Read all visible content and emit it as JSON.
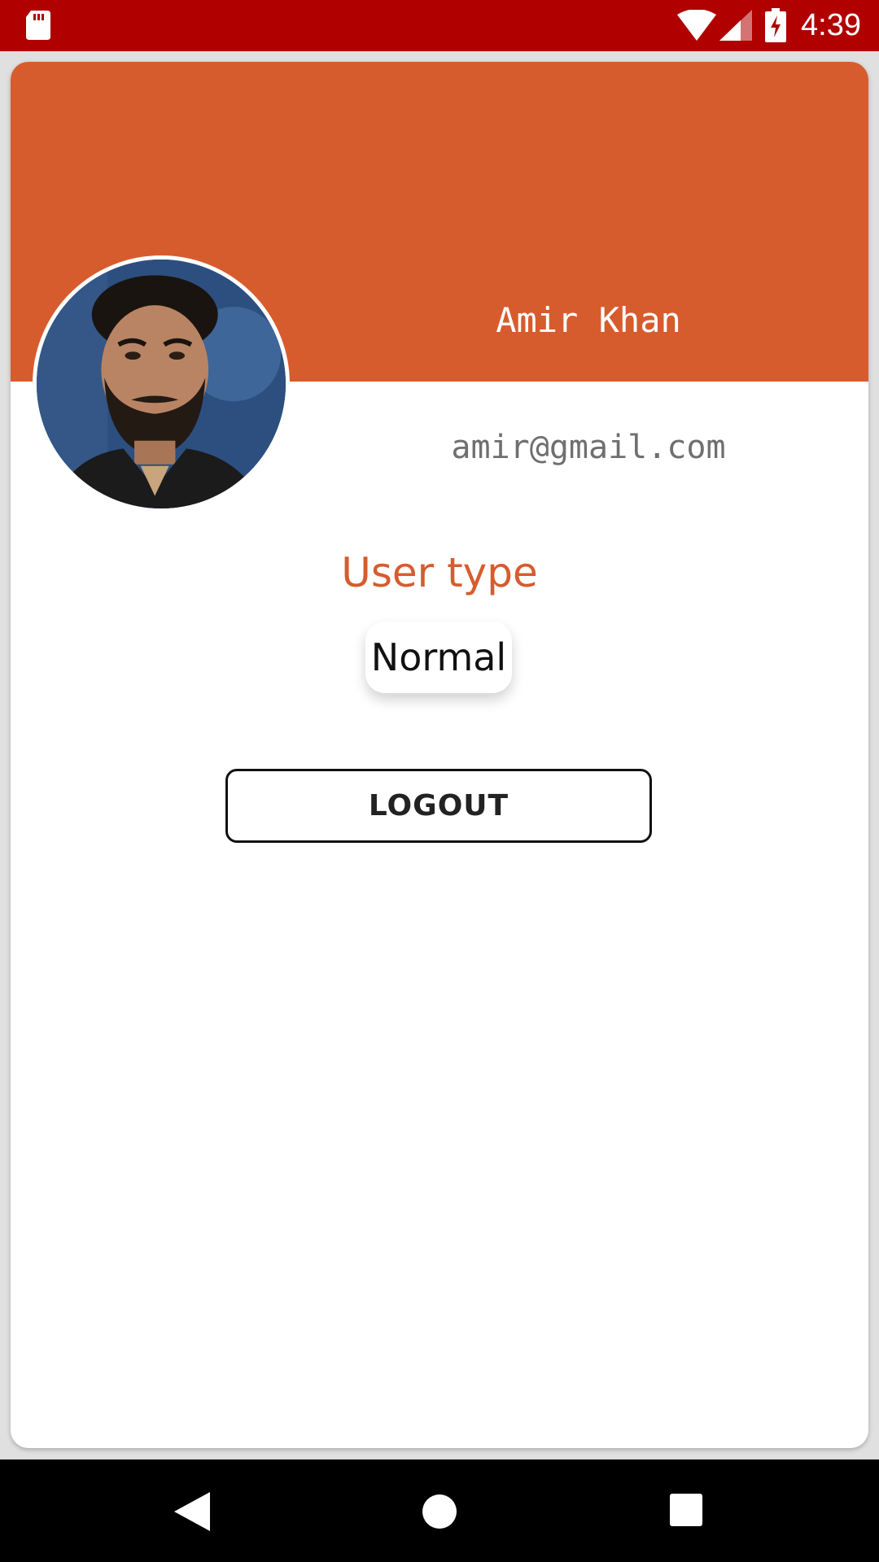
{
  "status_bar": {
    "time": "4:39",
    "icons": [
      "sd-card-icon",
      "wifi-icon",
      "signal-icon",
      "battery-charging-icon"
    ],
    "background": "#b00000"
  },
  "profile": {
    "name": "Amir Khan",
    "email": "amir@gmail.com",
    "user_type_label": "User type",
    "user_type_value": "Normal",
    "avatar": "profile-photo"
  },
  "actions": {
    "logout_label": "LOGOUT"
  },
  "nav_bar": {
    "icons": [
      "back-icon",
      "home-icon",
      "recents-icon"
    ]
  },
  "colors": {
    "accent": "#d65c2e",
    "status_bar": "#b00000",
    "email_text": "#6f6f6f"
  }
}
